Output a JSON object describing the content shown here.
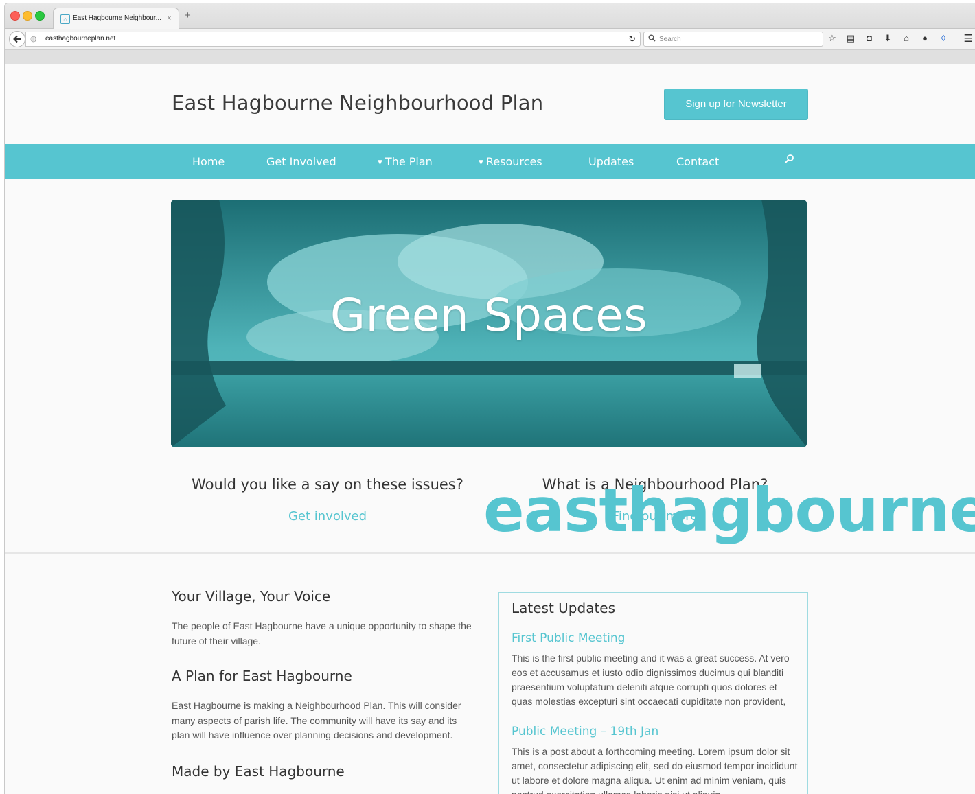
{
  "browser": {
    "tab_title": "East Hagbourne Neighbour...",
    "tab_close": "×",
    "new_tab": "+",
    "url": "easthagbourneplan.net",
    "search_placeholder": "Search",
    "toolbar_icons": [
      "star-icon",
      "reading-list-icon",
      "pocket-icon",
      "download-icon",
      "home-icon",
      "chat-icon",
      "drop-icon"
    ]
  },
  "site": {
    "title": "East Hagbourne Neighbourhood Plan",
    "newsletter_button": "Sign up for Newsletter",
    "accent_color": "#56c5d0"
  },
  "nav": {
    "items": [
      {
        "label": "Home",
        "dropdown": false
      },
      {
        "label": "Get Involved",
        "dropdown": false
      },
      {
        "label": "The Plan",
        "dropdown": true
      },
      {
        "label": "Resources",
        "dropdown": true
      },
      {
        "label": "Updates",
        "dropdown": false
      },
      {
        "label": "Contact",
        "dropdown": false
      }
    ]
  },
  "hero": {
    "title": "Green Spaces"
  },
  "cta": {
    "left_question": "Would you like a say on these issues?",
    "left_link": "Get involved",
    "right_question": "What is a Neighbourhood Plan?",
    "right_link": "Find out more"
  },
  "content": {
    "heading1": "Your Village, Your Voice",
    "para1": "The people of East Hagbourne have a unique opportunity to shape the future of their village.",
    "heading2": "A Plan for East Hagbourne",
    "para2": "East Hagbourne is making a Neighbourhood Plan. This will consider many aspects of parish life. The community will have its say and its plan will have influence over planning decisions and development.",
    "heading3": "Made by East Hagbourne"
  },
  "updates": {
    "title": "Latest Updates",
    "posts": [
      {
        "title": "First Public Meeting",
        "body": "This is the first public meeting and it was a great success. At vero eos et accusamus et iusto odio dignissimos ducimus qui blanditi praesentium voluptatum deleniti atque corrupti quos dolores et quas molestias excepturi sint occaecati cupiditate non provident,"
      },
      {
        "title": "Public Meeting – 19th Jan",
        "body": "This is a post about a forthcoming meeting. Lorem ipsum dolor sit amet, consectetur adipiscing elit, sed do eiusmod tempor incididunt ut labore et dolore magna aliqua. Ut enim ad minim veniam, quis nostrud exercitation ullamco laboris nisi ut aliquip"
      }
    ]
  },
  "overlay": {
    "logo_text": "easthagbourne"
  }
}
